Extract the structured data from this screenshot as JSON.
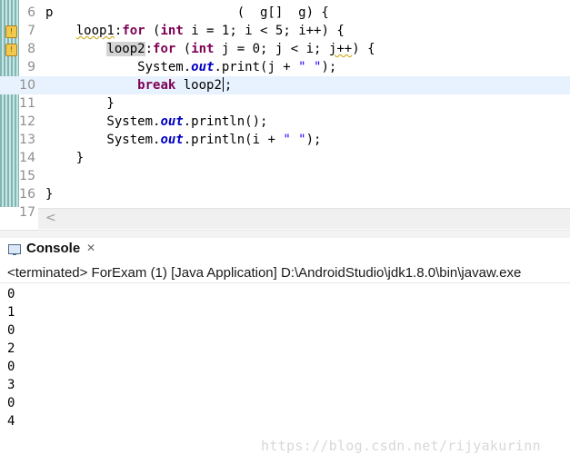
{
  "editor": {
    "lines": [
      {
        "num": "6",
        "tokens": [
          {
            "t": "p                        (  g[]  g) {",
            "c": "plain"
          }
        ]
      },
      {
        "num": "7",
        "tokens": [
          {
            "t": "    ",
            "c": "plain"
          },
          {
            "t": "loop1",
            "c": "warn"
          },
          {
            "t": ":",
            "c": "plain"
          },
          {
            "t": "for",
            "c": "kw"
          },
          {
            "t": " (",
            "c": "plain"
          },
          {
            "t": "int",
            "c": "kw"
          },
          {
            "t": " i = 1; i < 5; i++) {",
            "c": "plain"
          }
        ]
      },
      {
        "num": "8",
        "tokens": [
          {
            "t": "        ",
            "c": "plain"
          },
          {
            "t": "loop2",
            "c": "label-hl"
          },
          {
            "t": ":",
            "c": "plain"
          },
          {
            "t": "for",
            "c": "kw"
          },
          {
            "t": " (",
            "c": "plain"
          },
          {
            "t": "int",
            "c": "kw"
          },
          {
            "t": " j = 0; j < i; ",
            "c": "plain"
          },
          {
            "t": "j++",
            "c": "warn"
          },
          {
            "t": ") {",
            "c": "plain"
          }
        ]
      },
      {
        "num": "9",
        "tokens": [
          {
            "t": "            System.",
            "c": "plain"
          },
          {
            "t": "out",
            "c": "field"
          },
          {
            "t": ".print(j + ",
            "c": "plain"
          },
          {
            "t": "\" \"",
            "c": "str"
          },
          {
            "t": ");",
            "c": "plain"
          }
        ]
      },
      {
        "num": "10",
        "tokens": [
          {
            "t": "            ",
            "c": "plain"
          },
          {
            "t": "break",
            "c": "kw"
          },
          {
            "t": " loop2",
            "c": "plain"
          },
          {
            "t": "",
            "c": "caret"
          },
          {
            "t": ";",
            "c": "plain"
          }
        ]
      },
      {
        "num": "11",
        "tokens": [
          {
            "t": "        }",
            "c": "brace-hl"
          }
        ]
      },
      {
        "num": "12",
        "tokens": [
          {
            "t": "        System.",
            "c": "plain"
          },
          {
            "t": "out",
            "c": "field"
          },
          {
            "t": ".println();",
            "c": "plain"
          }
        ]
      },
      {
        "num": "13",
        "tokens": [
          {
            "t": "        System.",
            "c": "plain"
          },
          {
            "t": "out",
            "c": "field"
          },
          {
            "t": ".println(i + ",
            "c": "plain"
          },
          {
            "t": "\" \"",
            "c": "str"
          },
          {
            "t": ");",
            "c": "plain"
          }
        ]
      },
      {
        "num": "14",
        "tokens": [
          {
            "t": "    }",
            "c": "plain"
          }
        ]
      },
      {
        "num": "15",
        "tokens": []
      },
      {
        "num": "16",
        "tokens": [
          {
            "t": "}",
            "c": "plain"
          }
        ]
      },
      {
        "num": "17",
        "tokens": []
      }
    ],
    "current_line_index": 4,
    "warning_markers": [
      1,
      2
    ]
  },
  "console": {
    "tab_title": "Console",
    "close_glyph": "✕",
    "terminated_text": "<terminated> ForExam (1) [Java Application] D:\\AndroidStudio\\jdk1.8.0\\bin\\javaw.exe",
    "output": [
      "0",
      "1",
      "0",
      "2",
      "0",
      "3",
      "0",
      "4"
    ]
  },
  "scrollbar": {
    "left_arrow": "<"
  },
  "watermark": "https://blog.csdn.net/rijyakurinn",
  "colors": {
    "keyword": "#7f0055",
    "field": "#0000c0",
    "string": "#2a00ff",
    "current_line": "#e8f2fe"
  }
}
